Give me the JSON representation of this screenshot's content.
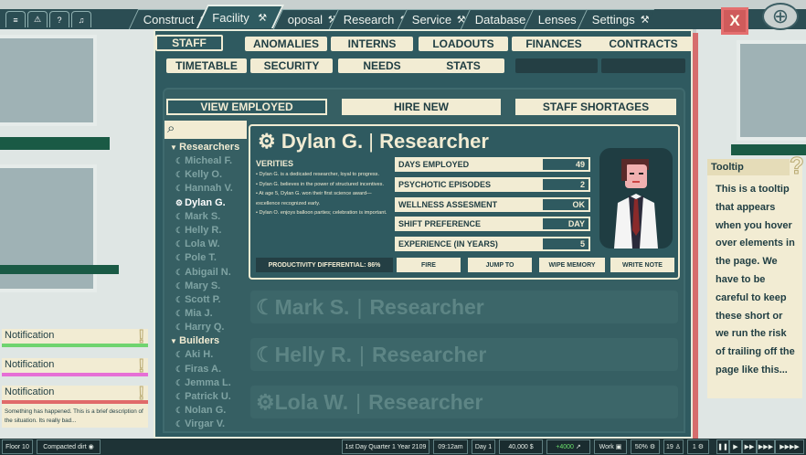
{
  "quick_icons": [
    "menu-icon",
    "warning-icon",
    "help-icon",
    "bell-icon"
  ],
  "nav_tabs": [
    {
      "label": "Construct",
      "icon": "hammer-icon",
      "active": false
    },
    {
      "label": "Facility",
      "icon": "hammer-icon",
      "active": true
    },
    {
      "label": "oposal",
      "icon": "hammer-icon",
      "active": false
    },
    {
      "label": "Research",
      "icon": "hammer-icon",
      "active": false
    },
    {
      "label": "Service",
      "icon": "hammer-icon",
      "active": false
    },
    {
      "label": "Database",
      "icon": "hammer-icon",
      "active": false
    },
    {
      "label": "Lenses",
      "icon": "hammer-icon",
      "active": false
    },
    {
      "label": "Settings",
      "icon": "hammer-icon",
      "active": false
    }
  ],
  "close_label": "X",
  "facility_tabs": {
    "row1": [
      "STAFF",
      "ANOMALIES",
      "INTERNS",
      "LOADOUTS",
      "FINANCES",
      "CONTRACTS"
    ],
    "row2": [
      "TIMETABLE",
      "SECURITY",
      "NEEDS",
      "STATS"
    ]
  },
  "staff_buttons": [
    "VIEW EMPLOYED",
    "HIRE NEW",
    "STAFF SHORTAGES"
  ],
  "staff_list": {
    "researchers_label": "Researchers",
    "researchers": [
      "Micheal F.",
      "Kelly O.",
      "Hannah V.",
      "Dylan G.",
      "Mark S.",
      "Helly R.",
      "Lola W.",
      "Pole T.",
      "Abigail N.",
      "Mary S.",
      "Scott P.",
      "Mia J.",
      "Harry Q."
    ],
    "builders_label": "Builders",
    "builders": [
      "Aki H.",
      "Firas A.",
      "Jemma L.",
      "Patrick U.",
      "Nolan G.",
      "Virgar V."
    ]
  },
  "selected_staff": {
    "name": "Dylan G.",
    "role": "Researcher",
    "verities_label": "VERITIES",
    "verities": [
      "Dylan G. is a dedicated researcher, loyal to progress.",
      "Dylan G. believes in the power of structured incentives.",
      "At age 5, Dylan G. won their first science award—excellence recognized early.",
      "Dylan O. enjoys balloon parties; celebration is important."
    ],
    "stats": [
      {
        "label": "DAYS EMPLOYED",
        "value": "49"
      },
      {
        "label": "PSYCHOTIC EPISODES",
        "value": "2"
      },
      {
        "label": "WELLNESS ASSESMENT",
        "value": "OK"
      },
      {
        "label": "SHIFT PREFERENCE",
        "value": "DAY"
      },
      {
        "label": "EXPERIENCE (IN YEARS)",
        "value": "5"
      }
    ],
    "productivity": "PRODUCTIVITY DIFFERENTIAL: 86%",
    "actions": [
      "FIRE",
      "JUMP TO",
      "WIPE MEMORY",
      "WRITE NOTE"
    ]
  },
  "other_cards": [
    {
      "name": "Mark S.",
      "role": "Researcher"
    },
    {
      "name": "Helly R.",
      "role": "Researcher"
    },
    {
      "name": "Lola W.",
      "role": "Researcher"
    }
  ],
  "tooltip": {
    "title": "Tooltip",
    "mark": "?",
    "body": "This is a tooltip that appears when you hover over elements in the page. We have to be careful to keep these short or we run the risk of trailing off the page like this..."
  },
  "notifications": [
    {
      "title": "Notification",
      "color": "#6fd46f",
      "mark": "!"
    },
    {
      "title": "Notification",
      "color": "#e66fd6",
      "mark": "!"
    },
    {
      "title": "Notification",
      "color": "#e06a6a",
      "mark": "!",
      "body": "Something has happened.  This is a brief description of the situation. Its really bad..."
    }
  ],
  "status_bar": {
    "floor": "Floor 10",
    "dirt": "Compacted dirt",
    "date": "1st Day Quarter 1 Year 2109",
    "time": "09:12am",
    "day": "Day 1",
    "money": "40,000",
    "income": "+4000",
    "mode": "Work",
    "percent": "50%",
    "staff_count": "19",
    "alerts": "1",
    "controls": [
      "pause",
      "play",
      "fast",
      "faster",
      "fastest"
    ]
  },
  "colors": {
    "panel": "#2f5a60",
    "cream": "#f2ecd3",
    "dark": "#1f3d42",
    "close": "#cf5b5b"
  }
}
